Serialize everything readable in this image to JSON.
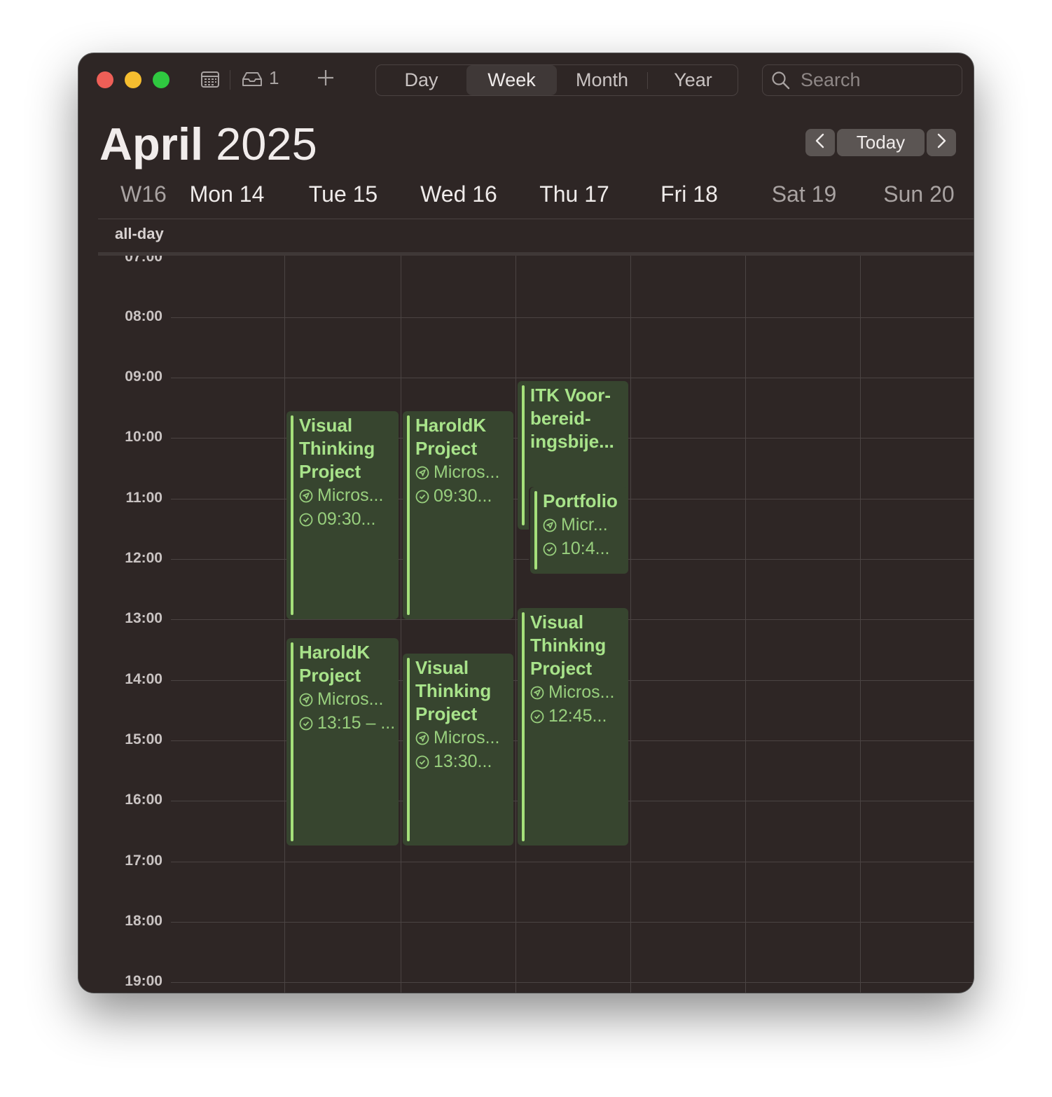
{
  "toolbar": {
    "inbox_count": "1",
    "views": [
      "Day",
      "Week",
      "Month",
      "Year"
    ],
    "active_view": "Week",
    "search_placeholder": "Search"
  },
  "header": {
    "month": "April",
    "year": "2025",
    "today_label": "Today",
    "week_label": "W16"
  },
  "days": [
    "Mon 14",
    "Tue 15",
    "Wed 16",
    "Thu 17",
    "Fri 18",
    "Sat 19",
    "Sun 20"
  ],
  "allday_label": "all-day",
  "hours": [
    "07:00",
    "08:00",
    "09:00",
    "10:00",
    "11:00",
    "12:00",
    "13:00",
    "14:00",
    "15:00",
    "16:00",
    "17:00",
    "18:00",
    "19:00"
  ],
  "events": {
    "tue_am": {
      "title": "Visual Thinking Project",
      "location": "Micros...",
      "time": "09:30..."
    },
    "wed_am": {
      "title": "HaroldK Project",
      "location": "Micros...",
      "time": "09:30..."
    },
    "thu_itk": {
      "title": "ITK Voor-bereid-ingsbije..."
    },
    "thu_portfolio": {
      "title": "Portfolio",
      "location": "Micr...",
      "time": "10:4..."
    },
    "tue_pm": {
      "title": "HaroldK Project",
      "location": "Micros...",
      "time": "13:15 – ..."
    },
    "wed_pm": {
      "title": "Visual Thinking Project",
      "location": "Micros...",
      "time": "13:30..."
    },
    "thu_pm": {
      "title": "Visual Thinking Project",
      "location": "Micros...",
      "time": "12:45..."
    }
  },
  "colors": {
    "window_bg": "#2e2625",
    "event_bg": "#37452f",
    "event_accent": "#a5e07a",
    "event_text": "#a8e38a"
  }
}
